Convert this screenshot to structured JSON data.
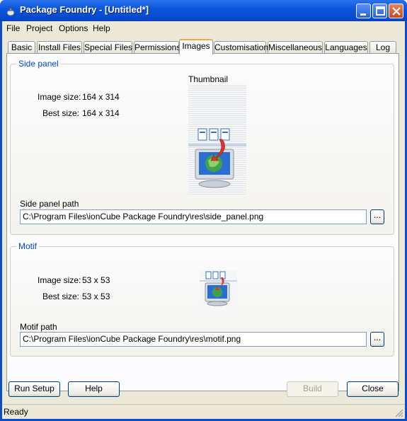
{
  "window": {
    "title": "Package Foundry - [Untitled*]",
    "icon": "package-foundry-app-icon",
    "controls": [
      "minimize-icon",
      "maximize-icon",
      "close-icon"
    ]
  },
  "menu": {
    "items": [
      "File",
      "Project",
      "Options",
      "Help"
    ]
  },
  "tabs": {
    "items": [
      "Basic",
      "Install Files",
      "Special Files",
      "Permissions",
      "Images",
      "Customisation",
      "Miscellaneous",
      "Languages",
      "Log"
    ],
    "active": "Images"
  },
  "side_panel": {
    "group_label": "Side panel",
    "image_size_label": "Image size:",
    "image_size_value": "164 x 314",
    "best_size_label": "Best size:",
    "best_size_value": "164 x 314",
    "thumbnail_label": "Thumbnail",
    "path_label": "Side panel path",
    "path_value": "C:\\Program Files\\ionCube Package Foundry\\res\\side_panel.png",
    "browse_label": "..."
  },
  "motif": {
    "group_label": "Motif",
    "image_size_label": "Image size:",
    "image_size_value": "53 x 53",
    "best_size_label": "Best size:",
    "best_size_value": "53 x 53",
    "path_label": "Motif path",
    "path_value": "C:\\Program Files\\ionCube Package Foundry\\res\\motif.png",
    "browse_label": "..."
  },
  "buttons": {
    "run_setup": "Run Setup",
    "help": "Help",
    "build": "Build",
    "close": "Close"
  },
  "status": {
    "text": "Ready"
  },
  "colors": {
    "titlebar": "#0b56dc",
    "group_label": "#0046d5",
    "active_tab_accent": "#f3a83c"
  }
}
